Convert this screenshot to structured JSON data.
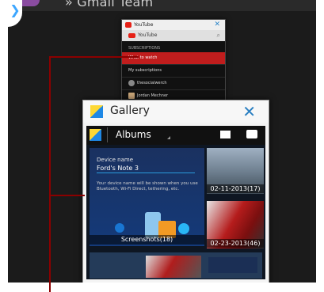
{
  "header": {
    "title": "» Gmail Team",
    "back_glyph": "❯"
  },
  "youtube": {
    "window_title": "YouTube",
    "app_bar": "YouTube",
    "section_label": "SUBSCRIPTIONS",
    "items": [
      "What to watch",
      "My subscriptions",
      "thesocialwerch",
      "Jordan Mechner"
    ],
    "close": "✕"
  },
  "gallery": {
    "window_title": "Gallery",
    "close": "✕",
    "album_selector": "Albums",
    "device_name_label": "Device name",
    "device_name_value": "Ford's Note 3",
    "device_description": "Your device name will be shown when you use Bluetooth, Wi-Fi Direct, tethering, etc.",
    "albums": [
      {
        "caption": "Screenshots(18)"
      },
      {
        "caption": "02-11-2013(17)"
      },
      {
        "caption": "02-23-2013(46)"
      }
    ]
  }
}
